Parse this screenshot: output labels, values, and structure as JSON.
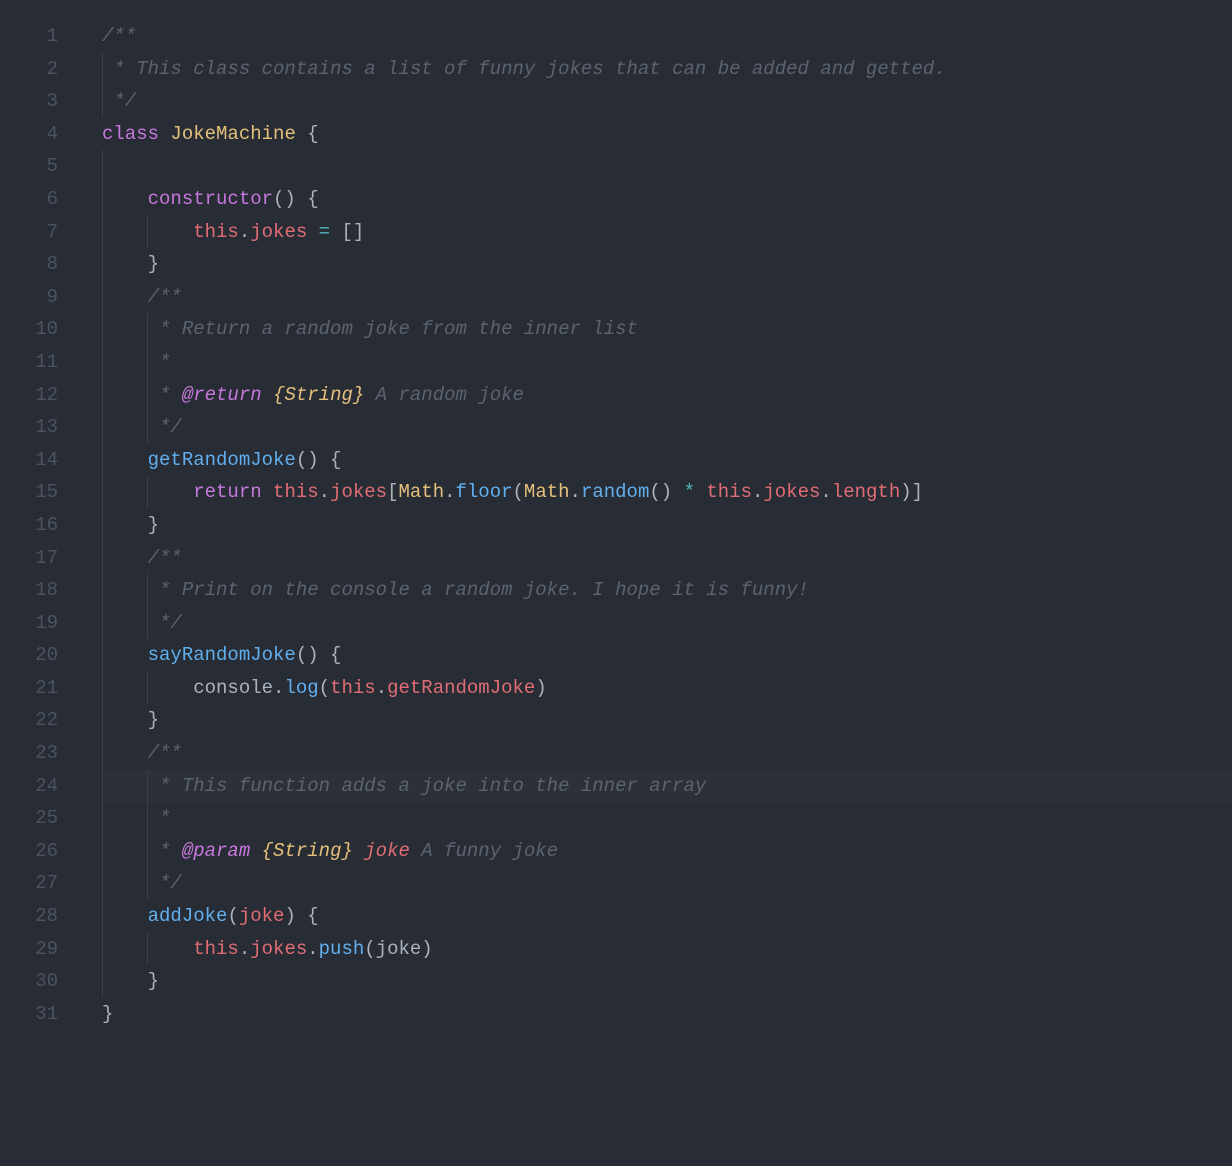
{
  "colors": {
    "bg": "#282c34",
    "gutter": "#4b5363",
    "comment": "#5c6370",
    "keyword": "#c678dd",
    "classname": "#e5c07b",
    "method": "#61afef",
    "this": "#e06c75",
    "operator": "#56b6c2",
    "punct": "#abb2bf"
  },
  "line_numbers": [
    "1",
    "2",
    "3",
    "4",
    "5",
    "6",
    "7",
    "8",
    "9",
    "10",
    "11",
    "12",
    "13",
    "14",
    "15",
    "16",
    "17",
    "18",
    "19",
    "20",
    "21",
    "22",
    "23",
    "24",
    "25",
    "26",
    "27",
    "28",
    "29",
    "30",
    "31"
  ],
  "code": {
    "l1": {
      "indent": 0,
      "guides": [],
      "tokens": [
        {
          "t": "/**",
          "c": "comment"
        }
      ]
    },
    "l2": {
      "indent": 0,
      "guides": [
        1
      ],
      "tokens": [
        {
          "t": " * This class contains a list of funny jokes that can be added and getted.",
          "c": "comment"
        }
      ]
    },
    "l3": {
      "indent": 0,
      "guides": [
        1
      ],
      "tokens": [
        {
          "t": " */",
          "c": "comment"
        }
      ]
    },
    "l4": {
      "indent": 0,
      "guides": [],
      "tokens": [
        {
          "t": "class",
          "c": "kw"
        },
        {
          "t": " ",
          "c": "plain"
        },
        {
          "t": "JokeMachine",
          "c": "classname"
        },
        {
          "t": " {",
          "c": "punct"
        }
      ]
    },
    "l5": {
      "indent": 0,
      "guides": [
        1
      ],
      "tokens": []
    },
    "l6": {
      "indent": 1,
      "guides": [
        1
      ],
      "tokens": [
        {
          "t": "constructor",
          "c": "kw"
        },
        {
          "t": "() {",
          "c": "punct"
        }
      ]
    },
    "l7": {
      "indent": 2,
      "guides": [
        1,
        2
      ],
      "tokens": [
        {
          "t": "this",
          "c": "this"
        },
        {
          "t": ".",
          "c": "punct"
        },
        {
          "t": "jokes",
          "c": "prop"
        },
        {
          "t": " ",
          "c": "plain"
        },
        {
          "t": "=",
          "c": "op"
        },
        {
          "t": " []",
          "c": "punct"
        }
      ]
    },
    "l8": {
      "indent": 1,
      "guides": [
        1
      ],
      "tokens": [
        {
          "t": "}",
          "c": "punct"
        }
      ]
    },
    "l9": {
      "indent": 1,
      "guides": [
        1
      ],
      "tokens": [
        {
          "t": "/**",
          "c": "comment"
        }
      ]
    },
    "l10": {
      "indent": 1,
      "guides": [
        1,
        2
      ],
      "tokens": [
        {
          "t": " * Return a random joke from the inner list",
          "c": "comment"
        }
      ]
    },
    "l11": {
      "indent": 1,
      "guides": [
        1,
        2
      ],
      "tokens": [
        {
          "t": " *",
          "c": "comment"
        }
      ]
    },
    "l12": {
      "indent": 1,
      "guides": [
        1,
        2
      ],
      "tokens": [
        {
          "t": " * ",
          "c": "comment"
        },
        {
          "t": "@return",
          "c": "doctag"
        },
        {
          "t": " ",
          "c": "comment"
        },
        {
          "t": "{String}",
          "c": "type-comment"
        },
        {
          "t": " A random joke",
          "c": "comment"
        }
      ]
    },
    "l13": {
      "indent": 1,
      "guides": [
        1,
        2
      ],
      "tokens": [
        {
          "t": " */",
          "c": "comment"
        }
      ]
    },
    "l14": {
      "indent": 1,
      "guides": [
        1
      ],
      "tokens": [
        {
          "t": "getRandomJoke",
          "c": "method"
        },
        {
          "t": "() {",
          "c": "punct"
        }
      ]
    },
    "l15": {
      "indent": 2,
      "guides": [
        1,
        2
      ],
      "tokens": [
        {
          "t": "return",
          "c": "kw"
        },
        {
          "t": " ",
          "c": "plain"
        },
        {
          "t": "this",
          "c": "this"
        },
        {
          "t": ".",
          "c": "punct"
        },
        {
          "t": "jokes",
          "c": "prop"
        },
        {
          "t": "[",
          "c": "punct"
        },
        {
          "t": "Math",
          "c": "global"
        },
        {
          "t": ".",
          "c": "punct"
        },
        {
          "t": "floor",
          "c": "fn"
        },
        {
          "t": "(",
          "c": "punct"
        },
        {
          "t": "Math",
          "c": "global"
        },
        {
          "t": ".",
          "c": "punct"
        },
        {
          "t": "random",
          "c": "fn"
        },
        {
          "t": "() ",
          "c": "punct"
        },
        {
          "t": "*",
          "c": "op"
        },
        {
          "t": " ",
          "c": "plain"
        },
        {
          "t": "this",
          "c": "this"
        },
        {
          "t": ".",
          "c": "punct"
        },
        {
          "t": "jokes",
          "c": "prop"
        },
        {
          "t": ".",
          "c": "punct"
        },
        {
          "t": "length",
          "c": "prop"
        },
        {
          "t": ")]",
          "c": "punct"
        }
      ]
    },
    "l16": {
      "indent": 1,
      "guides": [
        1
      ],
      "tokens": [
        {
          "t": "}",
          "c": "punct"
        }
      ]
    },
    "l17": {
      "indent": 1,
      "guides": [
        1
      ],
      "tokens": [
        {
          "t": "/**",
          "c": "comment"
        }
      ]
    },
    "l18": {
      "indent": 1,
      "guides": [
        1,
        2
      ],
      "tokens": [
        {
          "t": " * Print on the console a random joke. I hope it is funny!",
          "c": "comment"
        }
      ]
    },
    "l19": {
      "indent": 1,
      "guides": [
        1,
        2
      ],
      "tokens": [
        {
          "t": " */",
          "c": "comment"
        }
      ]
    },
    "l20": {
      "indent": 1,
      "guides": [
        1
      ],
      "tokens": [
        {
          "t": "sayRandomJoke",
          "c": "method"
        },
        {
          "t": "() {",
          "c": "punct"
        }
      ]
    },
    "l21": {
      "indent": 2,
      "guides": [
        1,
        2
      ],
      "tokens": [
        {
          "t": "console",
          "c": "plain"
        },
        {
          "t": ".",
          "c": "punct"
        },
        {
          "t": "log",
          "c": "fn"
        },
        {
          "t": "(",
          "c": "punct"
        },
        {
          "t": "this",
          "c": "this"
        },
        {
          "t": ".",
          "c": "punct"
        },
        {
          "t": "getRandomJoke",
          "c": "prop"
        },
        {
          "t": ")",
          "c": "punct"
        }
      ]
    },
    "l22": {
      "indent": 1,
      "guides": [
        1
      ],
      "tokens": [
        {
          "t": "}",
          "c": "punct"
        }
      ]
    },
    "l23": {
      "indent": 1,
      "guides": [
        1
      ],
      "tokens": [
        {
          "t": "/**",
          "c": "comment"
        }
      ]
    },
    "l24": {
      "indent": 1,
      "guides": [
        1,
        2
      ],
      "hl": true,
      "tokens": [
        {
          "t": " * This function adds a joke into the inner array",
          "c": "comment"
        }
      ]
    },
    "l25": {
      "indent": 1,
      "guides": [
        1,
        2
      ],
      "tokens": [
        {
          "t": " *",
          "c": "comment"
        }
      ]
    },
    "l26": {
      "indent": 1,
      "guides": [
        1,
        2
      ],
      "tokens": [
        {
          "t": " * ",
          "c": "comment"
        },
        {
          "t": "@param",
          "c": "doctag"
        },
        {
          "t": " ",
          "c": "comment"
        },
        {
          "t": "{String}",
          "c": "type-comment"
        },
        {
          "t": " ",
          "c": "comment"
        },
        {
          "t": "joke",
          "c": "param"
        },
        {
          "t": " A funny joke",
          "c": "comment"
        }
      ]
    },
    "l27": {
      "indent": 1,
      "guides": [
        1,
        2
      ],
      "tokens": [
        {
          "t": " */",
          "c": "comment"
        }
      ]
    },
    "l28": {
      "indent": 1,
      "guides": [
        1
      ],
      "tokens": [
        {
          "t": "addJoke",
          "c": "method"
        },
        {
          "t": "(",
          "c": "punct"
        },
        {
          "t": "joke",
          "c": "param2"
        },
        {
          "t": ") {",
          "c": "punct"
        }
      ]
    },
    "l29": {
      "indent": 2,
      "guides": [
        1,
        2
      ],
      "tokens": [
        {
          "t": "this",
          "c": "this"
        },
        {
          "t": ".",
          "c": "punct"
        },
        {
          "t": "jokes",
          "c": "prop"
        },
        {
          "t": ".",
          "c": "punct"
        },
        {
          "t": "push",
          "c": "fn"
        },
        {
          "t": "(",
          "c": "punct"
        },
        {
          "t": "joke",
          "c": "plain"
        },
        {
          "t": ")",
          "c": "punct"
        }
      ]
    },
    "l30": {
      "indent": 1,
      "guides": [
        1
      ],
      "tokens": [
        {
          "t": "}",
          "c": "punct"
        }
      ]
    },
    "l31": {
      "indent": 0,
      "guides": [],
      "tokens": [
        {
          "t": "}",
          "c": "punct"
        }
      ]
    }
  }
}
